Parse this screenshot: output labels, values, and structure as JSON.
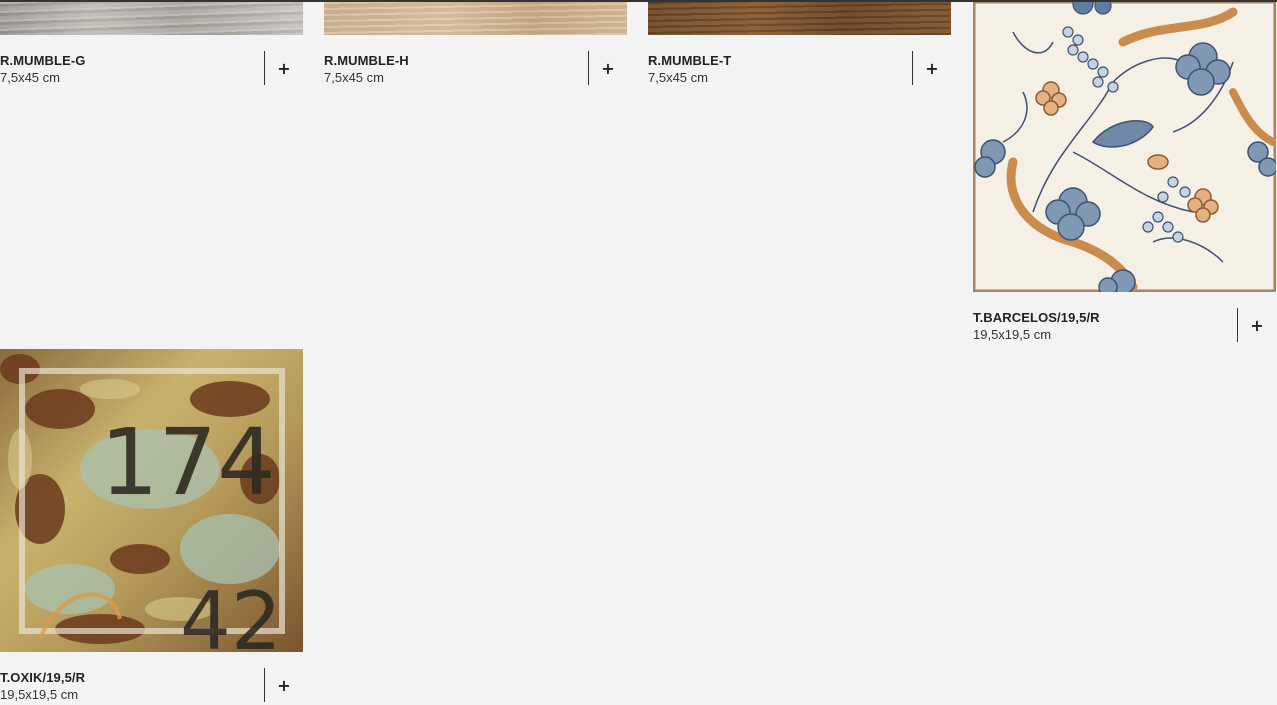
{
  "products": [
    {
      "name": "R.MUMBLE-G",
      "size": "7,5x45 cm",
      "add_label": "+"
    },
    {
      "name": "R.MUMBLE-H",
      "size": "7,5x45 cm",
      "add_label": "+"
    },
    {
      "name": "R.MUMBLE-T",
      "size": "7,5x45 cm",
      "add_label": "+"
    },
    {
      "name": "T.BARCELOS/19,5/R",
      "size": "19,5x19,5 cm",
      "add_label": "+"
    },
    {
      "name": "T.OXIK/19,5/R",
      "size": "19,5x19,5 cm",
      "add_label": "+"
    }
  ]
}
